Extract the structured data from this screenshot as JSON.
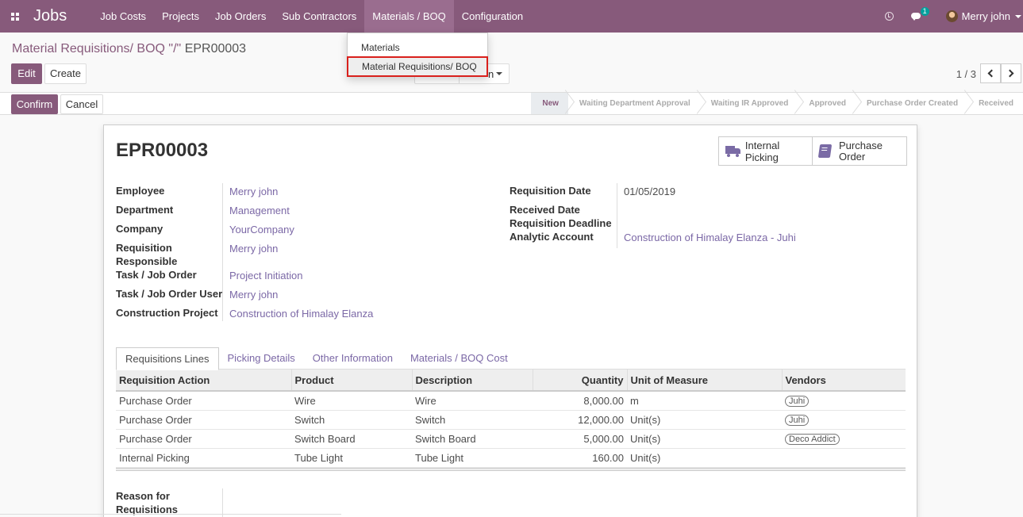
{
  "navbar": {
    "brand": "Jobs",
    "menu": [
      {
        "label": "Job Costs"
      },
      {
        "label": "Projects"
      },
      {
        "label": "Job Orders"
      },
      {
        "label": "Sub Contractors"
      },
      {
        "label": "Materials / BOQ"
      },
      {
        "label": "Configuration"
      }
    ],
    "chat_count": "1",
    "user": "Merry john",
    "accent_color": "#875a7b"
  },
  "dropdown": {
    "items": [
      {
        "label": "Materials"
      },
      {
        "label": "Material Requisitions/ BOQ"
      }
    ]
  },
  "breadcrumb": {
    "parent": "Material Requisitions/ BOQ",
    "separator": "\"/\"",
    "current": "EPR00003"
  },
  "actions": {
    "edit": "Edit",
    "create": "Create",
    "confirm": "Confirm",
    "cancel": "Cancel",
    "partial_button_text": "n"
  },
  "pager": {
    "value": "1 / 3"
  },
  "status_steps": [
    {
      "label": "New"
    },
    {
      "label": "Waiting Department Approval"
    },
    {
      "label": "Waiting IR Approved"
    },
    {
      "label": "Approved"
    },
    {
      "label": "Purchase Order Created"
    },
    {
      "label": "Received"
    }
  ],
  "record": {
    "title": "EPR00003",
    "smart_buttons": {
      "internal_picking": "Internal Picking",
      "purchase_order_1": "Purchase",
      "purchase_order_2": "Order"
    },
    "left_fields": {
      "employee": {
        "label": "Employee",
        "value": "Merry john"
      },
      "department": {
        "label": "Department",
        "value": "Management"
      },
      "company": {
        "label": "Company",
        "value": "YourCompany"
      },
      "req_resp": {
        "label1": "Requisition",
        "label2": "Responsible",
        "value": "Merry john"
      },
      "task": {
        "label": "Task / Job Order",
        "value": "Project Initiation"
      },
      "task_user": {
        "label": "Task / Job Order User",
        "value": "Merry john"
      },
      "project": {
        "label": "Construction Project",
        "value": "Construction of Himalay Elanza"
      }
    },
    "right_fields": {
      "req_date": {
        "label": "Requisition Date",
        "value": "01/05/2019"
      },
      "received_date": {
        "label": "Received Date",
        "value": ""
      },
      "deadline": {
        "label": "Requisition Deadline",
        "value": ""
      },
      "analytic": {
        "label": "Analytic Account",
        "value": "Construction of Himalay Elanza - Juhi"
      }
    },
    "reason": {
      "label1": "Reason for",
      "label2": "Requisitions"
    }
  },
  "tabs": [
    {
      "label": "Requisitions Lines"
    },
    {
      "label": "Picking Details"
    },
    {
      "label": "Other Information"
    },
    {
      "label": "Materials / BOQ Cost"
    }
  ],
  "table": {
    "headers": {
      "action": "Requisition Action",
      "product": "Product",
      "description": "Description",
      "quantity": "Quantity",
      "uom": "Unit of Measure",
      "vendors": "Vendors"
    },
    "rows": [
      {
        "action": "Purchase Order",
        "product": "Wire",
        "description": "Wire",
        "quantity": "8,000.00",
        "uom": "m",
        "vendor": "Juhi"
      },
      {
        "action": "Purchase Order",
        "product": "Switch",
        "description": "Switch",
        "quantity": "12,000.00",
        "uom": "Unit(s)",
        "vendor": "Juhi"
      },
      {
        "action": "Purchase Order",
        "product": "Switch Board",
        "description": "Switch Board",
        "quantity": "5,000.00",
        "uom": "Unit(s)",
        "vendor": "Deco Addict"
      },
      {
        "action": "Internal Picking",
        "product": "Tube Light",
        "description": "Tube Light",
        "quantity": "160.00",
        "uom": "Unit(s)",
        "vendor": ""
      }
    ]
  }
}
